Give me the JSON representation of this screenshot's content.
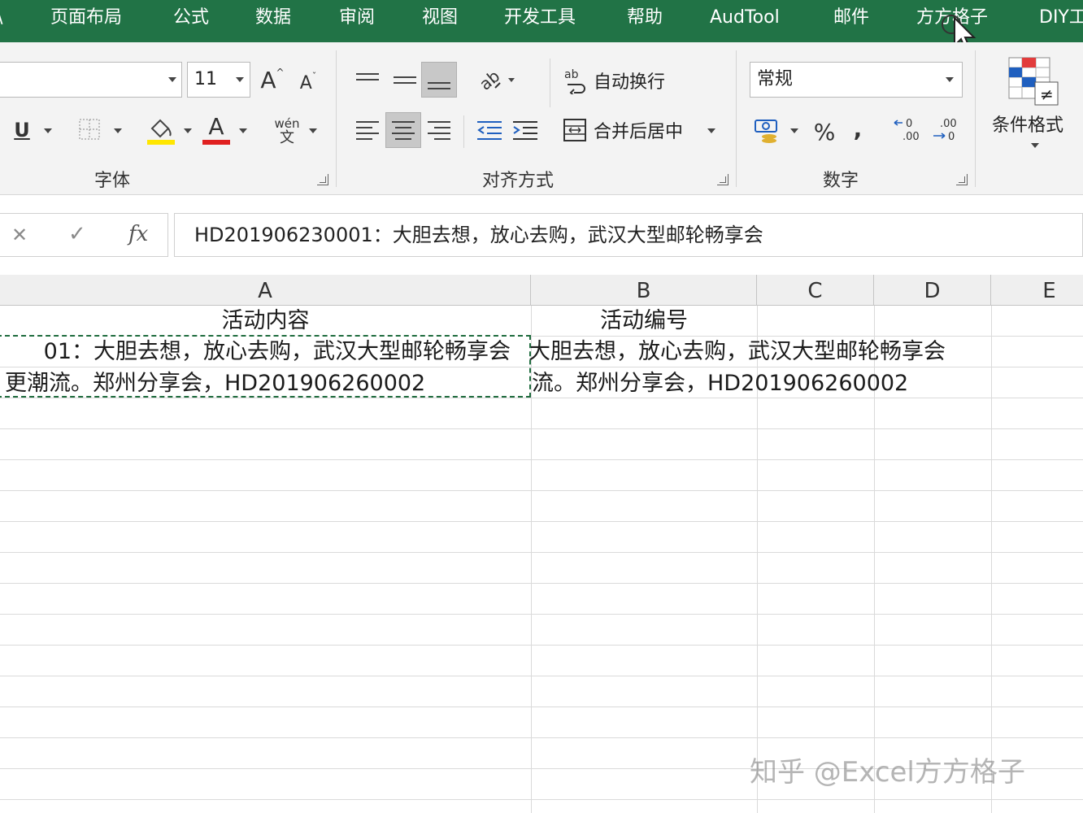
{
  "tabs": [
    {
      "label": "页面布局"
    },
    {
      "label": "公式"
    },
    {
      "label": "数据"
    },
    {
      "label": "审阅"
    },
    {
      "label": "视图"
    },
    {
      "label": "开发工具"
    },
    {
      "label": "帮助"
    },
    {
      "label": "AudTool"
    },
    {
      "label": "邮件"
    },
    {
      "label": "方方格子"
    },
    {
      "label": "DIY工"
    }
  ],
  "font_group": {
    "label": "字体",
    "font_size": "11",
    "underline": "U",
    "font_color_letter": "A",
    "grow_font": "A",
    "shrink_font": "A",
    "phonetic_top": "wén",
    "phonetic_bottom": "文",
    "highlight_color": "#ffe600",
    "font_color": "#e02020"
  },
  "align_group": {
    "label": "对齐方式",
    "wrap_text": "自动换行",
    "merge_center": "合并后居中"
  },
  "number_group": {
    "label": "数字",
    "format": "常规",
    "percent": "%",
    "comma": ","
  },
  "styles_group": {
    "conditional_format": "条件格式"
  },
  "formula_bar": {
    "fx": "fx",
    "cancel": "✕",
    "enter": "✓",
    "content": "HD201906230001：大胆去想，放心去购，武汉大型邮轮畅享会"
  },
  "columns": [
    "A",
    "B",
    "C",
    "D",
    "E"
  ],
  "cells": {
    "a1": "活动内容",
    "b1": "活动编号",
    "a2": "01：大胆去想，放心去购，武汉大型邮轮畅享会",
    "a3": "更潮流。郑州分享会，HD201906260002",
    "b2": "大胆去想，放心去购，武汉大型邮轮畅享会",
    "b3": "流。郑州分享会，HD201906260002"
  },
  "watermark": "知乎 @Excel方方格子"
}
